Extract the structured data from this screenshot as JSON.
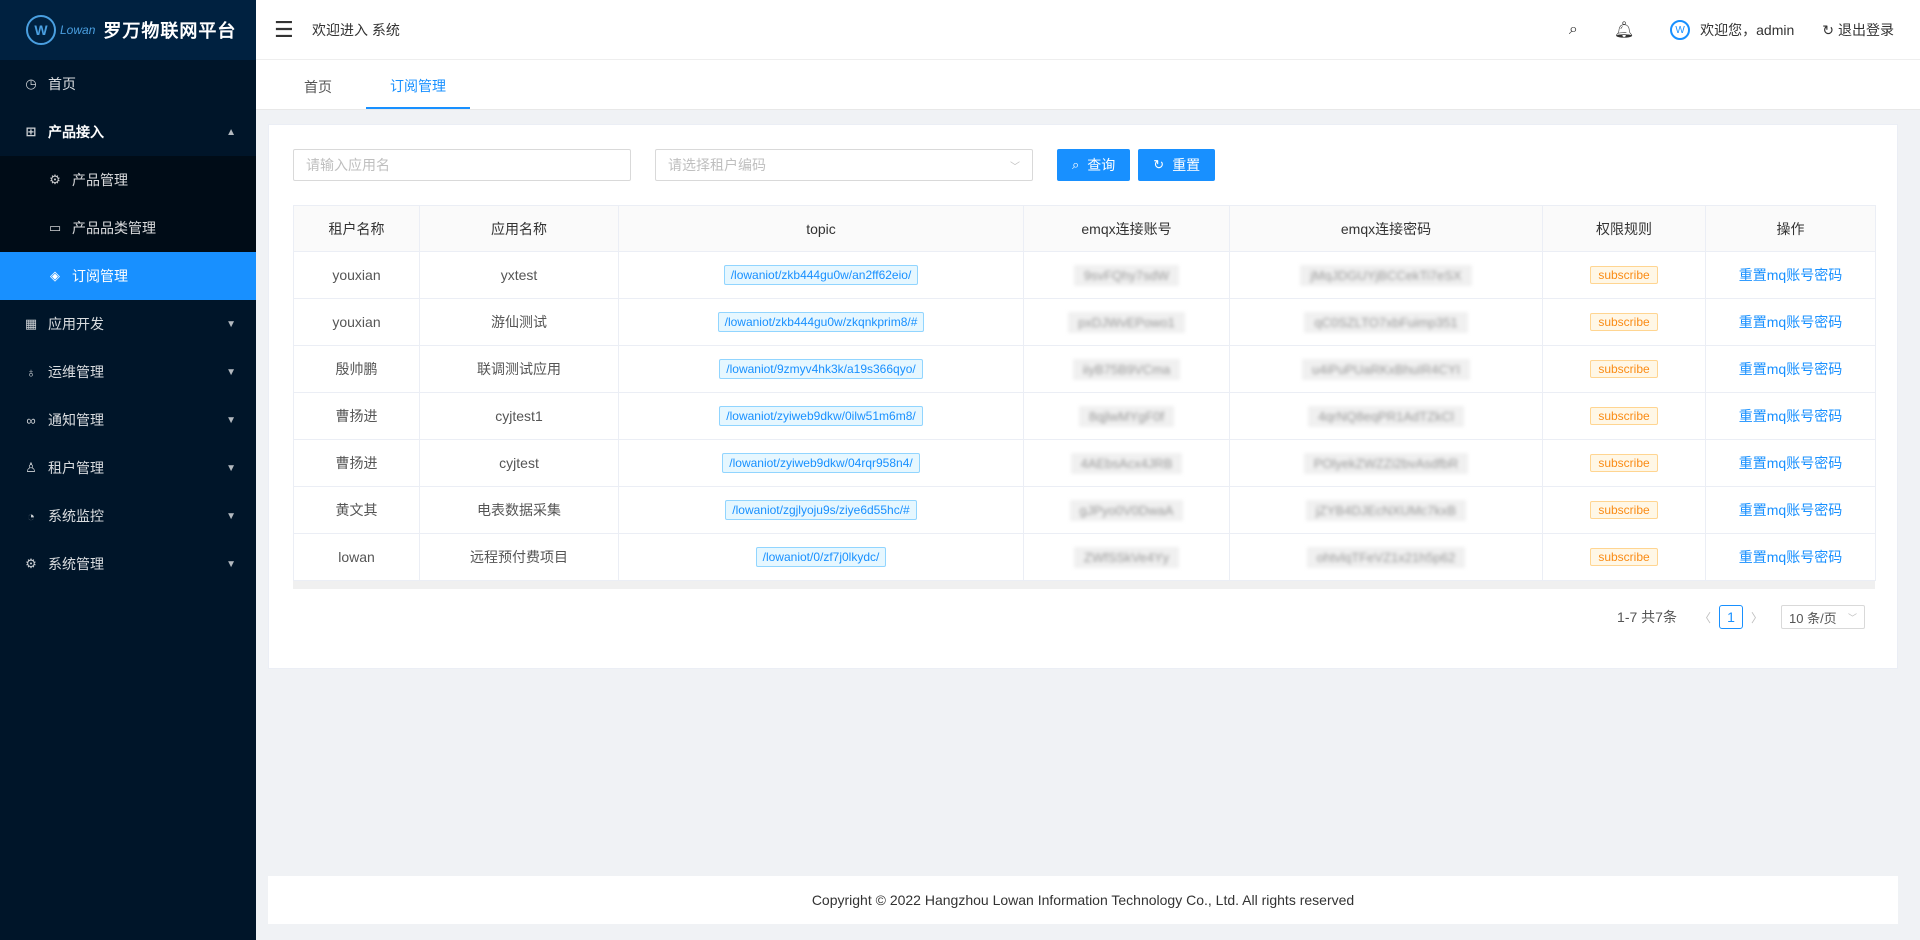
{
  "sidebar": {
    "logo_brand": "Lowan",
    "logo_title": "罗万物联网平台",
    "items": [
      {
        "label": "首页",
        "icon": "dashboard-icon"
      },
      {
        "label": "产品接入",
        "icon": "product-icon"
      },
      {
        "label": "应用开发",
        "icon": "appstore-icon"
      },
      {
        "label": "运维管理",
        "icon": "bulb-icon"
      },
      {
        "label": "通知管理",
        "icon": "link-icon"
      },
      {
        "label": "租户管理",
        "icon": "user-icon"
      },
      {
        "label": "系统监控",
        "icon": "monitor-icon"
      },
      {
        "label": "系统管理",
        "icon": "setting-icon"
      }
    ],
    "subitems": [
      {
        "label": "产品管理",
        "icon": "gear-small-icon"
      },
      {
        "label": "产品品类管理",
        "icon": "container-icon"
      },
      {
        "label": "订阅管理",
        "icon": "tag-icon"
      }
    ]
  },
  "header": {
    "welcome": "欢迎进入 系统",
    "user_text": "欢迎您，admin",
    "logout": "退出登录"
  },
  "tabs": [
    {
      "label": "首页"
    },
    {
      "label": "订阅管理"
    }
  ],
  "filters": {
    "app_placeholder": "请输入应用名",
    "tenant_placeholder": "请选择租户编码",
    "query_label": "查询",
    "reset_label": "重置"
  },
  "table": {
    "columns": [
      "租户名称",
      "应用名称",
      "topic",
      "emqx连接账号",
      "emqx连接密码",
      "权限规则",
      "操作"
    ],
    "rows": [
      {
        "tenant": "youxian",
        "app": "yxtest",
        "topic": "/lowaniot/zkb444gu0w/an2ff62eio/",
        "account": "9svFQhy7sdW",
        "password": "jMqJDGUYjBCCekTi7eSX",
        "rule": "subscribe",
        "action": "重置mq账号密码"
      },
      {
        "tenant": "youxian",
        "app": "游仙测试",
        "topic": "/lowaniot/zkb444gu0w/zkqnkprim8/#",
        "account": "pxDJWvEPowo1",
        "password": "qC0SZLTO7xbFuimp351",
        "rule": "subscribe",
        "action": "重置mq账号密码"
      },
      {
        "tenant": "殷帅鹏",
        "app": "联调测试应用",
        "topic": "/lowaniot/9zmyv4hk3k/a19s366qyo/",
        "account": "iiyB75B9VCma",
        "password": "u4iPuPUaRKxBhuIR4CYI",
        "rule": "subscribe",
        "action": "重置mq账号密码"
      },
      {
        "tenant": "曹扬进",
        "app": "cyjtest1",
        "topic": "/lowaniot/zyiweb9dkw/0ilw51m6m8/",
        "account": "8qjlwMYgF0f",
        "password": "4qrNQ8eqPR1AdTZkCl",
        "rule": "subscribe",
        "action": "重置mq账号密码"
      },
      {
        "tenant": "曹扬进",
        "app": "cyjtest",
        "topic": "/lowaniot/zyiweb9dkw/04rqr958n4/",
        "account": "4AEbsAcx4JRB",
        "password": "POlyekZWZZi2bvAsdfbR",
        "rule": "subscribe",
        "action": "重置mq账号密码"
      },
      {
        "tenant": "黄文其",
        "app": "电表数据采集",
        "topic": "/lowaniot/zgjlyoju9s/ziye6d55hc/#",
        "account": "gJPyo0V0DwaA",
        "password": "jZYB4DJEcNXUMc7kxB",
        "rule": "subscribe",
        "action": "重置mq账号密码"
      },
      {
        "tenant": "lowan",
        "app": "远程预付费项目",
        "topic": "/lowaniot/0/zf7j0lkydc/",
        "account": "ZWfSSkVe4Yy",
        "password": "ohtvlqTFeVZ1x21h5p62",
        "rule": "subscribe",
        "action": "重置mq账号密码"
      }
    ]
  },
  "pagination": {
    "total_text": "1-7 共7条",
    "current_page": "1",
    "page_size": "10 条/页"
  },
  "footer": {
    "copyright": "Copyright © 2022 Hangzhou Lowan Information Technology Co., Ltd. All rights reserved"
  }
}
